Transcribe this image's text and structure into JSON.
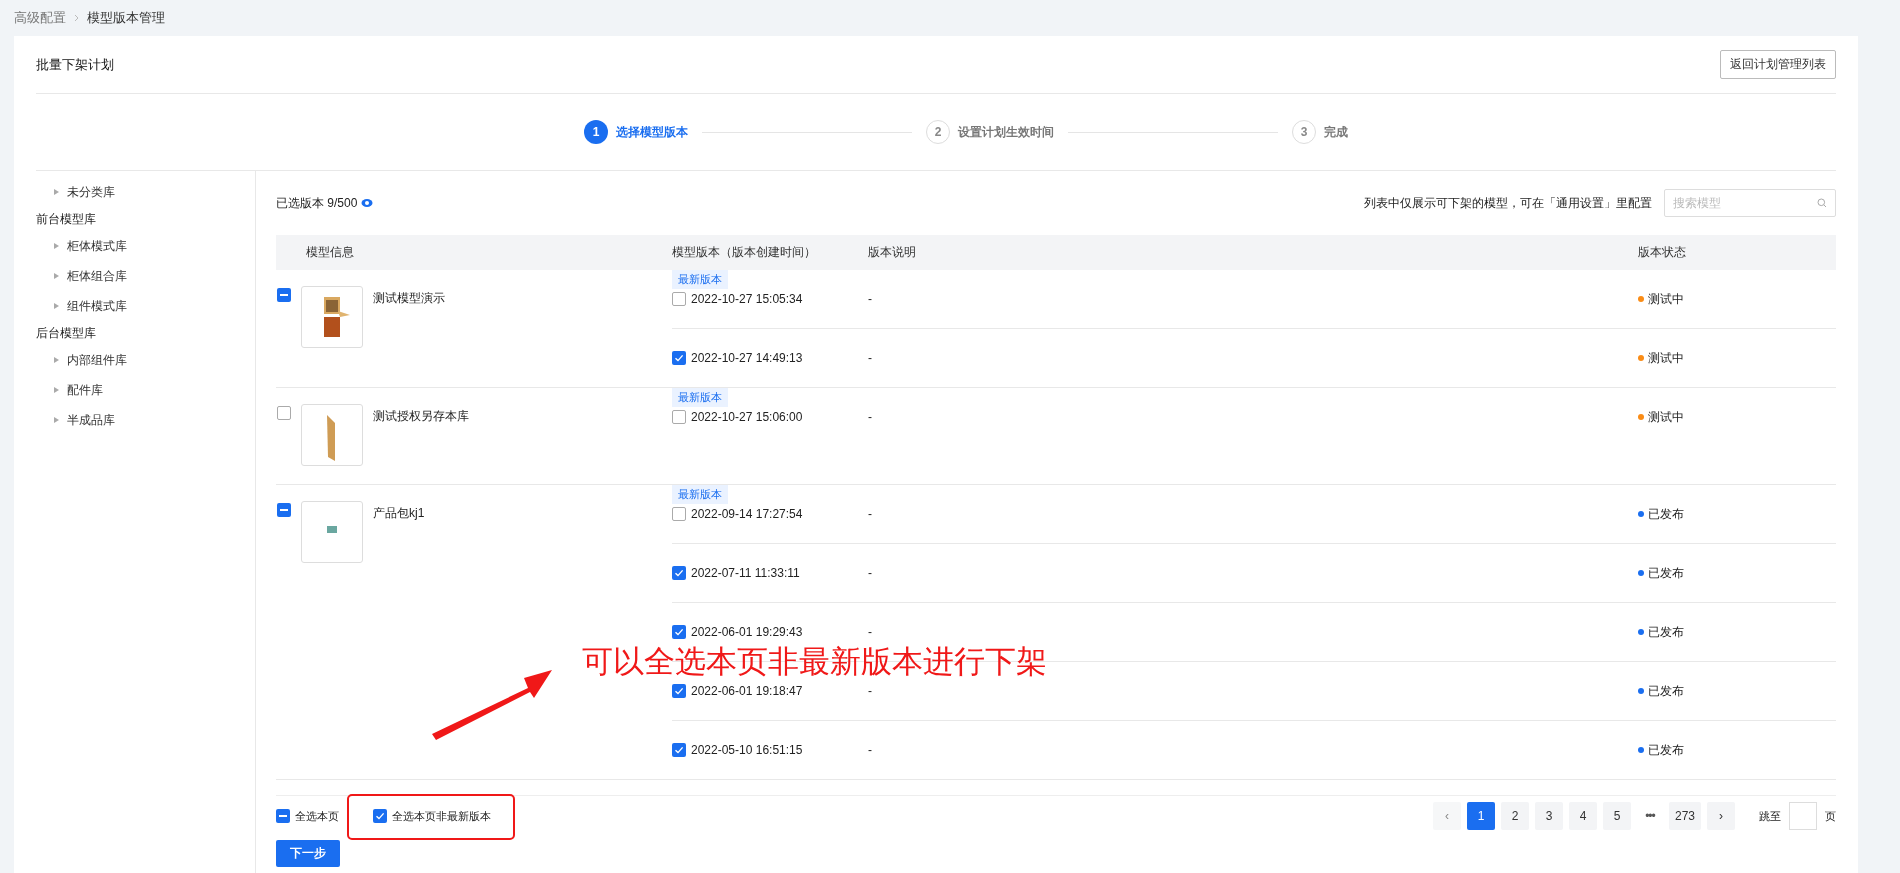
{
  "breadcrumb": [
    {
      "label": "高级配置"
    },
    {
      "label": "模型版本管理"
    }
  ],
  "page_title": "批量下架计划",
  "back_button": "返回计划管理列表",
  "steps": [
    {
      "number": "1",
      "label": "选择模型版本",
      "selected": true
    },
    {
      "number": "2",
      "label": "设置计划生效时间",
      "selected": false
    },
    {
      "number": "3",
      "label": "完成",
      "selected": false
    }
  ],
  "sidebar": {
    "items": [
      {
        "children": [
          {
            "label": "未分类库"
          }
        ]
      },
      {
        "label": "前台模型库",
        "children": [
          {
            "label": "柜体模式库"
          },
          {
            "label": "柜体组合库"
          },
          {
            "label": "组件模式库"
          }
        ]
      },
      {
        "label": "后台模型库",
        "children": [
          {
            "label": "内部组件库"
          },
          {
            "label": "配件库"
          },
          {
            "label": "半成品库"
          }
        ]
      }
    ]
  },
  "selected_summary": "已选版本 9/500",
  "note": "列表中仅展示可下架的模型，可在「通用设置」里配置",
  "search": {
    "placeholder": "搜索模型"
  },
  "table": {
    "columns": [
      "模型信息",
      "模型版本（版本创建时间）",
      "版本说明",
      "版本状态"
    ],
    "models": [
      {
        "name": "测试模型演示",
        "indeterminate": true,
        "kind": "cabinet",
        "versions": [
          {
            "tag": "最新版本",
            "checked": false,
            "time": "2022-10-27 15:05:34",
            "description": "-",
            "status": "测试中",
            "color": "#fa8c16"
          },
          {
            "checked": true,
            "time": "2022-10-27 14:49:13",
            "description": "-",
            "status": "测试中",
            "color": "#fa8c16"
          }
        ]
      },
      {
        "name": "测试授权另存本库",
        "indeterminate": false,
        "kind": "panel",
        "versions": [
          {
            "tag": "最新版本",
            "checked": false,
            "time": "2022-10-27 15:06:00",
            "description": "-",
            "status": "测试中",
            "color": "#fa8c16"
          }
        ]
      },
      {
        "name": "产品包kj1",
        "indeterminate": true,
        "kind": "box",
        "versions": [
          {
            "tag": "最新版本",
            "checked": false,
            "time": "2022-09-14 17:27:54",
            "description": "-",
            "status": "已发布",
            "color": "#1a6ef0"
          },
          {
            "checked": true,
            "time": "2022-07-11 11:33:11",
            "description": "-",
            "status": "已发布",
            "color": "#1a6ef0"
          },
          {
            "checked": true,
            "time": "2022-06-01 19:29:43",
            "description": "-",
            "status": "已发布",
            "color": "#1a6ef0"
          },
          {
            "checked": true,
            "time": "2022-06-01 19:18:47",
            "description": "-",
            "status": "已发布",
            "color": "#1a6ef0"
          },
          {
            "checked": true,
            "time": "2022-05-10 16:51:15",
            "description": "-",
            "status": "已发布",
            "color": "#1a6ef0"
          }
        ]
      }
    ]
  },
  "footer": {
    "select_all": {
      "label": "全选本页",
      "indeterminate": true
    },
    "select_old": {
      "label": "全选本页非最新版本",
      "checked": true
    },
    "pagination": [
      {
        "kind": "prev",
        "label": "‹",
        "disabled": true
      },
      {
        "kind": "page",
        "label": "1",
        "selected": true
      },
      {
        "kind": "page",
        "label": "2",
        "selected": false
      },
      {
        "kind": "page",
        "label": "3",
        "selected": false
      },
      {
        "kind": "page",
        "label": "4",
        "selected": false
      },
      {
        "kind": "page",
        "label": "5",
        "selected": false
      },
      {
        "kind": "ellipsis",
        "label": "•••"
      },
      {
        "kind": "page",
        "label": "273",
        "selected": false
      },
      {
        "kind": "next",
        "label": "›",
        "disabled": false
      }
    ],
    "jump_label": "跳至",
    "jump_suffix": "页"
  },
  "next_button": "下一步",
  "annotation": {
    "text": "可以全选本页非最新版本进行下架"
  }
}
